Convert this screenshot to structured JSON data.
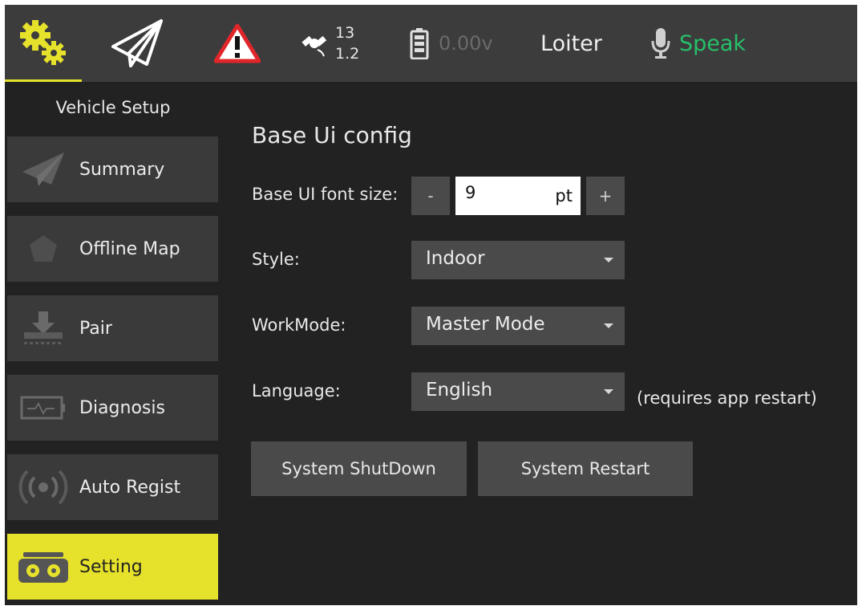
{
  "topbar": {
    "gps_count": "13",
    "gps_hdop": "1.2",
    "battery_voltage": "0.00v",
    "flight_mode": "Loiter",
    "speak_label": "Speak",
    "accent_color": "#e6e12a",
    "speak_color": "#27c06a"
  },
  "sidebar": {
    "title": "Vehicle Setup",
    "items": [
      {
        "label": "Summary",
        "icon": "paper-plane-icon"
      },
      {
        "label": "Offline Map",
        "icon": "pentagon-icon"
      },
      {
        "label": "Pair",
        "icon": "download-tray-icon"
      },
      {
        "label": "Diagnosis",
        "icon": "battery-pulse-icon"
      },
      {
        "label": "Auto Regist",
        "icon": "broadcast-icon"
      },
      {
        "label": "Setting",
        "icon": "controller-icon",
        "active": true
      }
    ]
  },
  "content": {
    "title": "Base Ui config",
    "font_size_label": "Base UI font size:",
    "font_size_value": "9",
    "font_size_unit": "pt",
    "decrement": "-",
    "increment": "+",
    "style_label": "Style:",
    "style_value": "Indoor",
    "workmode_label": "WorkMode:",
    "workmode_value": "Master Mode",
    "language_label": "Language:",
    "language_value": "English",
    "language_note": "(requires app restart)",
    "shutdown_label": "System ShutDown",
    "restart_label": "System Restart"
  }
}
